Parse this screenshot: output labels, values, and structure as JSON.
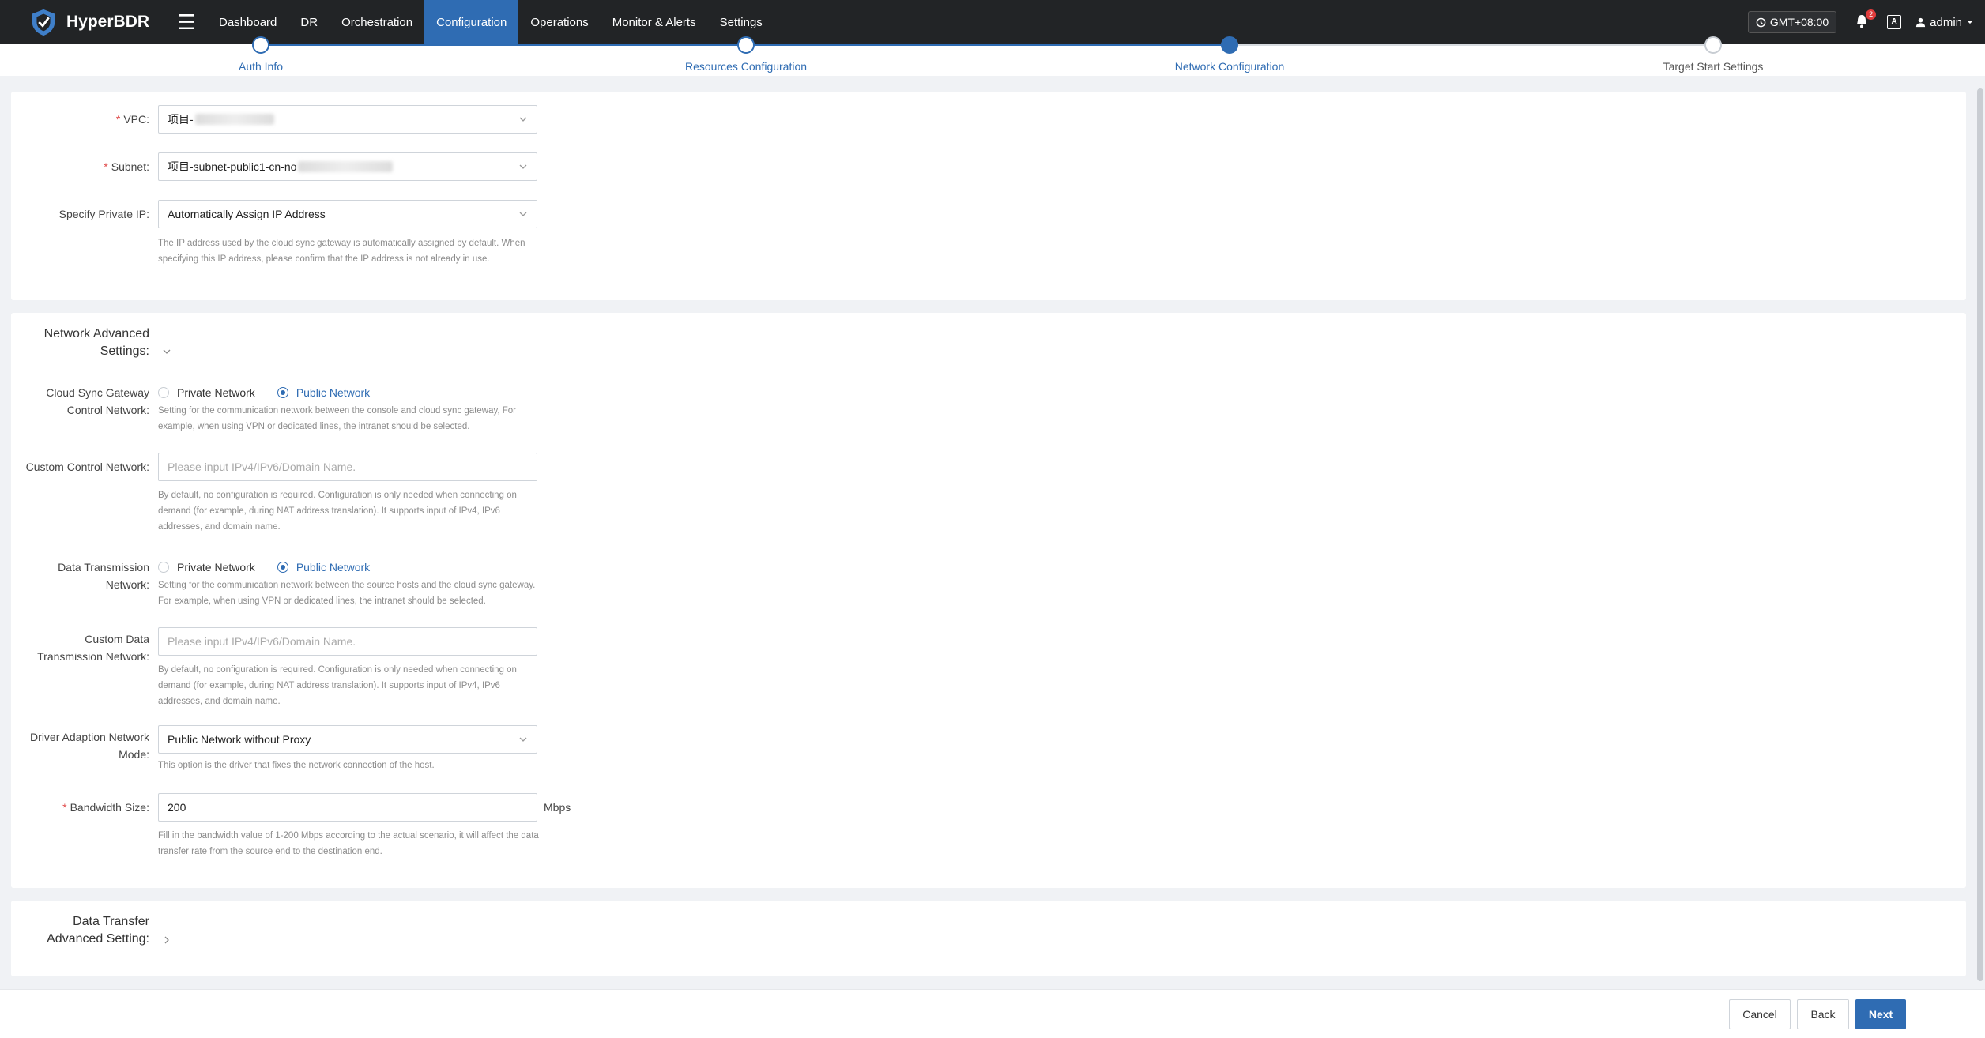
{
  "app": {
    "name": "HyperBDR"
  },
  "nav": {
    "items": [
      "Dashboard",
      "DR",
      "Orchestration",
      "Configuration",
      "Operations",
      "Monitor & Alerts",
      "Settings"
    ],
    "active": "Configuration",
    "timezone": "GMT+08:00",
    "notification_count": "2",
    "lang_badge": "A",
    "user": "admin"
  },
  "steps": [
    {
      "label": "Auth Info",
      "state": "done"
    },
    {
      "label": "Resources Configuration",
      "state": "done"
    },
    {
      "label": "Network Configuration",
      "state": "current"
    },
    {
      "label": "Target Start Settings",
      "state": "todo"
    }
  ],
  "network": {
    "vpc": {
      "label": "VPC:",
      "value": "项目-"
    },
    "subnet": {
      "label": "Subnet:",
      "value": "项目-subnet-public1-cn-no"
    },
    "private_ip": {
      "label": "Specify Private IP:",
      "value": "Automatically Assign IP Address",
      "hint": "The IP address used by the cloud sync gateway is automatically assigned by default. When specifying this IP address, please confirm that the IP address is not already in use."
    }
  },
  "advanced": {
    "title": "Network Advanced Settings:",
    "control_network": {
      "label": "Cloud Sync Gateway Control Network:",
      "options": [
        "Private Network",
        "Public Network"
      ],
      "selected": "Public Network",
      "hint": "Setting for the communication network between the console and cloud sync gateway, For example, when using VPN or dedicated lines, the intranet should be selected."
    },
    "custom_control": {
      "label": "Custom Control Network:",
      "placeholder": "Please input IPv4/IPv6/Domain Name.",
      "hint": "By default, no configuration is required. Configuration is only needed when connecting on demand (for example, during NAT address translation). It supports input of IPv4, IPv6 addresses, and domain name."
    },
    "data_transmission": {
      "label": "Data Transmission Network:",
      "options": [
        "Private Network",
        "Public Network"
      ],
      "selected": "Public Network",
      "hint": "Setting for the communication network between the source hosts and the cloud sync gateway. For example, when using VPN or dedicated lines, the intranet should be selected."
    },
    "custom_data": {
      "label": "Custom Data Transmission Network:",
      "placeholder": "Please input IPv4/IPv6/Domain Name.",
      "hint": "By default, no configuration is required. Configuration is only needed when connecting on demand (for example, during NAT address translation). It supports input of IPv4, IPv6 addresses, and domain name."
    },
    "driver_mode": {
      "label": "Driver Adaption Network Mode:",
      "value": "Public Network without Proxy",
      "hint": "This option is the driver that fixes the network connection of the host."
    },
    "bandwidth": {
      "label": "Bandwidth Size:",
      "value": "200",
      "unit": "Mbps",
      "hint": "Fill in the bandwidth value of 1-200 Mbps according to the actual scenario, it will affect the data transfer rate from the source end to the destination end."
    }
  },
  "data_transfer": {
    "title": "Data Transfer Advanced Setting:"
  },
  "footer": {
    "cancel": "Cancel",
    "back": "Back",
    "next": "Next"
  },
  "colors": {
    "primary": "#2f6cb3",
    "nav_bg": "#222426",
    "required": "#e04b4b"
  }
}
